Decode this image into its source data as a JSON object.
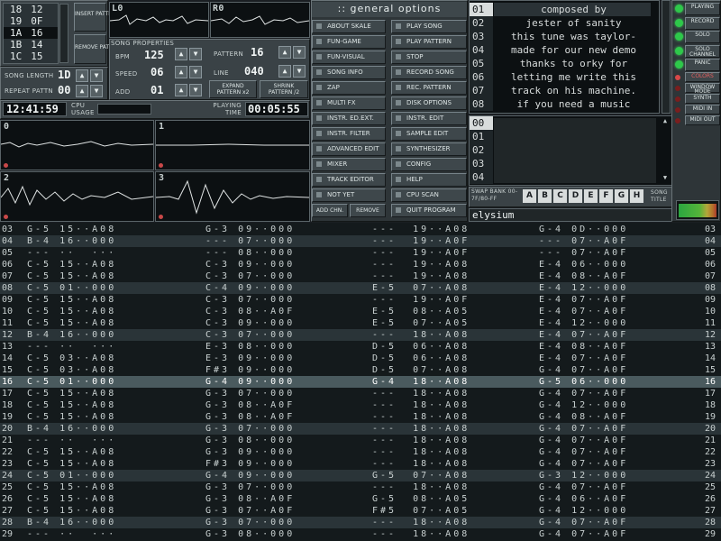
{
  "positions": [
    "18",
    "19",
    "1A",
    "1B",
    "1C"
  ],
  "patterns": [
    "12",
    "0F",
    "16",
    "14",
    "15"
  ],
  "insert_pattern": "INSERT PATTERN",
  "remove_pattern": "REMOVE PATTERN",
  "song_length_label": "SONG LENGTH",
  "song_length": "1D",
  "repeat_pattern_label": "REPEAT PATTN",
  "repeat_pattern": "00",
  "song_properties_label": "SONG PROPERTIES",
  "bpm_label": "BPM",
  "bpm": "125",
  "speed_label": "SPEED",
  "speed": "06",
  "add_label": "ADD",
  "add": "01",
  "pattern_label": "PATTERN",
  "pattern": "16",
  "line_label": "LINE",
  "line": "040",
  "expand_pattern": "EXPAND PATTERN x2",
  "shrink_pattern": "SHRINK PATTERN /2",
  "clock": "12:41:59",
  "cpu_usage_label": "CPU USAGE",
  "playing_time_label": "PLAYING TIME",
  "playing_time": "00:05:55",
  "scope_left_label": "L0",
  "scope_right_label": "R0",
  "track_scopes": [
    "0",
    "1",
    "2",
    "3"
  ],
  "general_options_title": ":: general options",
  "left_buttons": [
    "ABOUT SKALE",
    "FUN-GAME",
    "FUN-VISUAL",
    "SONG INFO",
    "ZAP",
    "MULTI FX",
    "INSTR. ED.EXT.",
    "INSTR. FILTER",
    "ADVANCED EDIT",
    "MIXER",
    "TRACK EDITOR",
    "NOT YET"
  ],
  "right_buttons": [
    "PLAY SONG",
    "PLAY PATTERN",
    "STOP",
    "RECORD SONG",
    "REC. PATTERN",
    "DISK OPTIONS",
    "INSTR. EDIT",
    "SAMPLE EDIT",
    "SYNTHESIZER",
    "CONFIG",
    "HELP",
    "CPU SCAN",
    "QUIT PROGRAM"
  ],
  "add_channel": "ADD CHN.",
  "remove_channel": "REMOVE",
  "info_numbers": [
    "01",
    "02",
    "03",
    "04",
    "05",
    "06",
    "07",
    "08"
  ],
  "info_lines": [
    "composed by",
    "jester of sanity",
    "this tune was taylor-",
    "made for our new demo",
    "thanks to orky for",
    "letting me write this",
    "track on his machine.",
    "if you need a music"
  ],
  "sample_numbers": [
    "00",
    "01",
    "02",
    "03",
    "04"
  ],
  "swap_bank_label": "SWAP BANK 00-7F/80-FF",
  "banks": [
    "A",
    "B",
    "C",
    "D",
    "E",
    "F",
    "G",
    "H"
  ],
  "song_title_label": "SONG TITLE",
  "song_title": "elysium",
  "status_buttons": [
    "PLAYING",
    "RECORD",
    "SOLO",
    "SOLO CHANNEL",
    "PANIC",
    "COLORS",
    "WINDOW MODE",
    "SYNTH",
    "MIDI IN",
    "MIDI OUT"
  ],
  "tracker_rows": [
    {
      "n": "03",
      "c": [
        "G-5 15··A08",
        "G-3 09··000",
        "---  19··A08",
        "G-4 0D··000"
      ]
    },
    {
      "n": "04",
      "c": [
        "B-4 16··000",
        "--- 07··000",
        "---  19··A0F",
        "--- 07··A0F"
      ]
    },
    {
      "n": "05",
      "c": [
        "--- ··  ···",
        "--- 08··000",
        "---  19··A0F",
        "--- 07··A0F"
      ]
    },
    {
      "n": "06",
      "c": [
        "C-5 15··A08",
        "C-3 09··000",
        "---  19··A08",
        "E-4 06··000"
      ]
    },
    {
      "n": "07",
      "c": [
        "C-5 15··A08",
        "C-3 07··000",
        "---  19··A08",
        "E-4 08··A0F"
      ]
    },
    {
      "n": "08",
      "c": [
        "C-5 01··000",
        "C-4 09··000",
        "E-5  07··A08",
        "E-4 12··000"
      ]
    },
    {
      "n": "09",
      "c": [
        "C-5 15··A08",
        "C-3 07··000",
        "---  19··A0F",
        "E-4 07··A0F"
      ]
    },
    {
      "n": "10",
      "c": [
        "C-5 15··A08",
        "C-3 08··A0F",
        "E-5  08··A05",
        "E-4 07··A0F"
      ]
    },
    {
      "n": "11",
      "c": [
        "C-5 15··A08",
        "C-3 09··000",
        "E-5  07··A05",
        "E-4 12··000"
      ]
    },
    {
      "n": "12",
      "c": [
        "B-4 16··000",
        "C-3 07··000",
        "---  18··A08",
        "E-4 07··A0F"
      ]
    },
    {
      "n": "13",
      "c": [
        "--- ··  ···",
        "E-3 08··000",
        "D-5  06··A08",
        "E-4 08··A0F"
      ]
    },
    {
      "n": "14",
      "c": [
        "C-5 03··A08",
        "E-3 09··000",
        "D-5  06··A08",
        "E-4 07··A0F"
      ]
    },
    {
      "n": "15",
      "c": [
        "C-5 03··A08",
        "F#3 09··000",
        "D-5  07··A08",
        "G-4 07··A0F"
      ]
    },
    {
      "n": "16",
      "c": [
        "C-5 01··000",
        "G-4 09··000",
        "G-4  18··A08",
        "G-5 06··000"
      ]
    },
    {
      "n": "17",
      "c": [
        "C-5 15··A08",
        "G-3 07··000",
        "---  18··A08",
        "G-4 07··A0F"
      ]
    },
    {
      "n": "18",
      "c": [
        "C-5 15··A08",
        "G-3 08··A0F",
        "---  18··A08",
        "G-4 12··000"
      ]
    },
    {
      "n": "19",
      "c": [
        "C-5 15··A08",
        "G-3 08··A0F",
        "---  18··A08",
        "G-4 08··A0F"
      ]
    },
    {
      "n": "20",
      "c": [
        "B-4 16··000",
        "G-3 07··000",
        "---  18··A08",
        "G-4 07··A0F"
      ]
    },
    {
      "n": "21",
      "c": [
        "--- ··  ···",
        "G-3 08··000",
        "---  18··A08",
        "G-4 07··A0F"
      ]
    },
    {
      "n": "22",
      "c": [
        "C-5 15··A08",
        "G-3 09··000",
        "---  18··A08",
        "G-4 07··A0F"
      ]
    },
    {
      "n": "23",
      "c": [
        "C-5 15··A08",
        "F#3 09··000",
        "---  18··A08",
        "G-4 07··A0F"
      ]
    },
    {
      "n": "24",
      "c": [
        "C-5 01··000",
        "G-4 09··000",
        "G-5  07··A08",
        "G-3 12··000"
      ]
    },
    {
      "n": "25",
      "c": [
        "C-5 15··A08",
        "G-3 07··000",
        "---  18··A08",
        "G-4 07··A0F"
      ]
    },
    {
      "n": "26",
      "c": [
        "C-5 15··A08",
        "G-3 08··A0F",
        "G-5  08··A05",
        "G-4 06··A0F"
      ]
    },
    {
      "n": "27",
      "c": [
        "C-5 15··A08",
        "G-3 07··A0F",
        "F#5  07··A05",
        "G-4 12··000"
      ]
    },
    {
      "n": "28",
      "c": [
        "B-4 16··000",
        "G-3 07··000",
        "---  18··A08",
        "G-4 07··A0F"
      ]
    },
    {
      "n": "29",
      "c": [
        "--- ··  ···",
        "G-3 08··000",
        "---  18··A08",
        "G-4 07··A0F"
      ]
    }
  ]
}
